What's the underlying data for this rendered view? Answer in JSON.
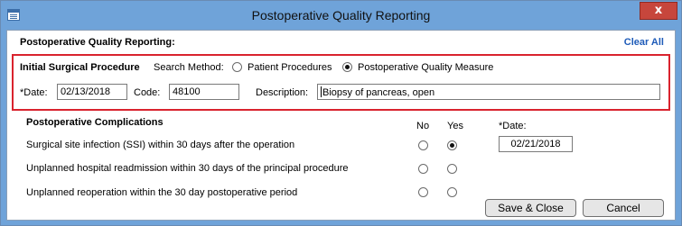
{
  "window": {
    "title": "Postoperative Quality Reporting",
    "close_glyph": "x"
  },
  "header": {
    "title": "Postoperative Quality Reporting:",
    "clear_all": "Clear All"
  },
  "initial_procedure": {
    "heading": "Initial Surgical Procedure",
    "search_method_label": "Search Method:",
    "options": [
      {
        "label": "Patient Procedures",
        "selected": false
      },
      {
        "label": "Postoperative Quality Measure",
        "selected": true
      }
    ],
    "date_label": "*Date:",
    "date_value": "02/13/2018",
    "code_label": "Code:",
    "code_value": "48100",
    "description_label": "Description:",
    "description_value": "Biopsy of pancreas, open"
  },
  "complications": {
    "heading": "Postoperative Complications",
    "col_no": "No",
    "col_yes": "Yes",
    "col_date": "*Date:",
    "rows": [
      {
        "label": "Surgical site infection (SSI) within 30 days after the operation",
        "answer": "yes",
        "date": "02/21/2018"
      },
      {
        "label": "Unplanned hospital readmission within 30 days of the principal procedure",
        "answer": null,
        "date": ""
      },
      {
        "label": "Unplanned reoperation within the 30 day postoperative period",
        "answer": null,
        "date": ""
      }
    ]
  },
  "buttons": {
    "save_close": "Save & Close",
    "cancel": "Cancel"
  },
  "colors": {
    "titlebar": "#6fa3d9",
    "accent_link": "#1e5bb8",
    "highlight_border": "#d9232e"
  }
}
